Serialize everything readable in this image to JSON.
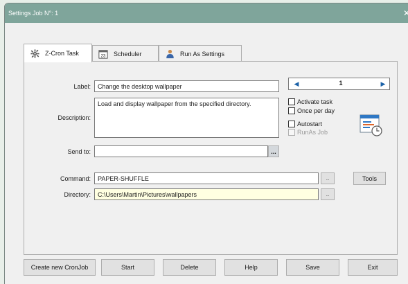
{
  "window": {
    "title": "Settings Job N°: 1",
    "close_glyph": "✕"
  },
  "tabs": [
    {
      "label": "Z-Cron Task",
      "icon": "gear-icon",
      "active": true
    },
    {
      "label": "Scheduler",
      "icon": "calendar-icon",
      "active": false
    },
    {
      "label": "Run As Settings",
      "icon": "user-icon",
      "active": false
    }
  ],
  "task": {
    "label_caption": "Label:",
    "label_value": "Change the desktop wallpaper",
    "description_caption": "Description:",
    "description_value": "Load and display wallpaper from the specified directory.",
    "sendto_caption": "Send to:",
    "sendto_value": "",
    "sendto_browse": "...",
    "command_caption": "Command:",
    "command_value": "PAPER-SHUFFLE",
    "command_browse": "..",
    "tools_label": "Tools",
    "directory_caption": "Directory:",
    "directory_value": "C:\\Users\\Martin\\Pictures\\wallpapers",
    "directory_browse": ".."
  },
  "spinner": {
    "value": "1",
    "left_glyph": "◀",
    "right_glyph": "▶"
  },
  "options": {
    "activate_task": "Activate task",
    "once_per_day": "Once per day",
    "autostart": "Autostart",
    "runas_job": "RunAs Job"
  },
  "buttons": {
    "create": "Create new CronJob",
    "start": "Start",
    "delete": "Delete",
    "help": "Help",
    "save": "Save",
    "exit": "Exit"
  },
  "colors": {
    "titlebar": "#7fa59b",
    "directory_field": "#ffffe1",
    "accent_blue": "#1c62a8"
  }
}
